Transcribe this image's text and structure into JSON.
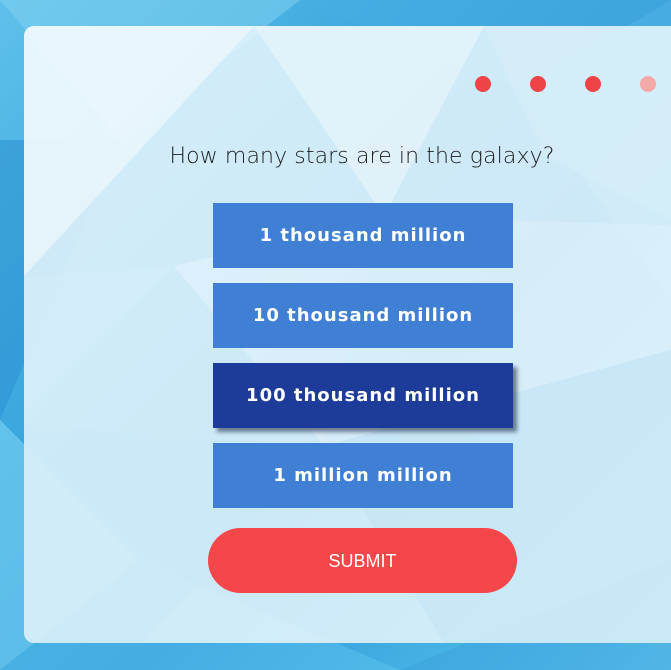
{
  "quiz": {
    "question": "How many stars are in the galaxy?",
    "options": [
      {
        "label": "1 thousand million",
        "selected": false
      },
      {
        "label": "10 thousand million",
        "selected": false
      },
      {
        "label": "100 thousand million",
        "selected": true
      },
      {
        "label": "1 million million",
        "selected": false
      }
    ],
    "submit_label": "SUBMIT"
  },
  "progress": {
    "steps": [
      {
        "state": "active"
      },
      {
        "state": "active"
      },
      {
        "state": "active"
      },
      {
        "state": "upcoming"
      }
    ]
  },
  "colors": {
    "option": "#3f7fd4",
    "option_selected": "#1d3b98",
    "submit": "#f5464a",
    "dot_active": "#ee4448",
    "dot_upcoming": "#f3a9a7"
  }
}
